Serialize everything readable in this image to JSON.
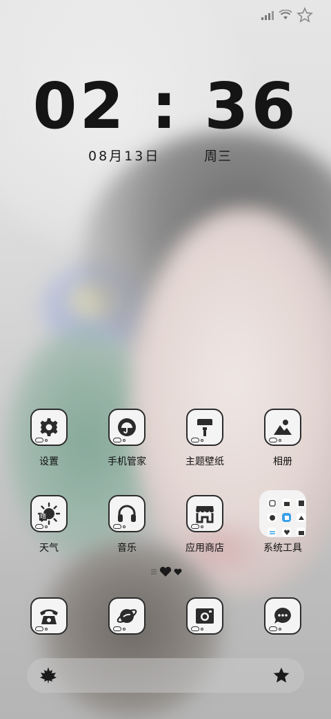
{
  "status_bar": {
    "icons": [
      "signal-icon",
      "wifi-icon",
      "star-outline-icon"
    ]
  },
  "lockscreen": {
    "time": "02:36",
    "date": "08月13日",
    "weekday": "周三"
  },
  "apps": [
    {
      "label": "设置",
      "icon": "gear-icon"
    },
    {
      "label": "手机管家",
      "icon": "umbrella-icon"
    },
    {
      "label": "主题壁纸",
      "icon": "paint-roller-icon"
    },
    {
      "label": "相册",
      "icon": "photo-icon"
    },
    {
      "label": "天气",
      "icon": "sun-icon",
      "icon_text": "晴"
    },
    {
      "label": "音乐",
      "icon": "headphones-icon"
    },
    {
      "label": "应用商店",
      "icon": "store-icon"
    },
    {
      "label": "系统工具",
      "icon": "folder-icon"
    }
  ],
  "dock": [
    {
      "icon": "phone-icon"
    },
    {
      "icon": "browser-planet-icon"
    },
    {
      "icon": "camera-icon"
    },
    {
      "icon": "message-icon"
    }
  ],
  "bottom_bar": {
    "left_icon": "maple-leaf-icon",
    "right_icon": "star-icon"
  },
  "pager": {
    "icons": [
      "menu-icon",
      "heart-icon",
      "heart-small-icon"
    ]
  },
  "colors": {
    "icon_fill": "#2b2b2b",
    "icon_bg": "#f4f4f4",
    "folder_accent": "#3aa0e8"
  }
}
